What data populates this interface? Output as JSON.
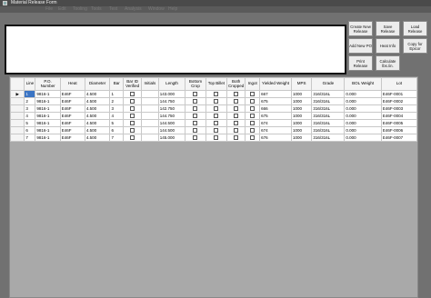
{
  "window": {
    "title": "Material Release Form"
  },
  "menu": {
    "items": [
      "File",
      "Edit",
      "Tooling",
      "Tools",
      "Test",
      "Analysis",
      "Window",
      "Help"
    ]
  },
  "buttons": {
    "create_new_release": "Create New Release",
    "save_release": "Save Release",
    "load_release": "Load Release",
    "add_new_po": "Add New PO",
    "heat_info": "Heat Info",
    "copy_for_epicor": "Copy for Epicor",
    "print_release": "Print Release",
    "calculate_lbs_in": "Calculate lbs./in."
  },
  "grid": {
    "columns": [
      "Line",
      "P.O. Number",
      "Heat",
      "Diameter",
      "Bar",
      "Bar ID Verified",
      "Initials",
      "Length",
      "Bottom Crop",
      "Top Billet",
      "Both Cropped",
      "Ingot",
      "Yielded Weight",
      "MPS",
      "Grade",
      "BOL Weight",
      "Lot"
    ],
    "rows": [
      {
        "line": "1",
        "po": "9816-1",
        "heat": "E46F",
        "diameter": "4.500",
        "bar": "1",
        "length": "143.000",
        "yielded": "667",
        "mps": "1000",
        "grade": "316/316L",
        "bol": "0.000",
        "lot": "E46F-0001"
      },
      {
        "line": "2",
        "po": "9816-1",
        "heat": "E46F",
        "diameter": "4.500",
        "bar": "2",
        "length": "144.750",
        "yielded": "675",
        "mps": "1000",
        "grade": "316/316L",
        "bol": "0.000",
        "lot": "E46F-0002"
      },
      {
        "line": "3",
        "po": "9816-1",
        "heat": "E46F",
        "diameter": "4.500",
        "bar": "3",
        "length": "142.750",
        "yielded": "666",
        "mps": "1000",
        "grade": "316/316L",
        "bol": "0.000",
        "lot": "E46F-0003"
      },
      {
        "line": "4",
        "po": "9816-1",
        "heat": "E46F",
        "diameter": "4.500",
        "bar": "4",
        "length": "144.750",
        "yielded": "675",
        "mps": "1000",
        "grade": "316/316L",
        "bol": "0.000",
        "lot": "E46F-0004"
      },
      {
        "line": "5",
        "po": "9816-1",
        "heat": "E46F",
        "diameter": "4.500",
        "bar": "5",
        "length": "144.500",
        "yielded": "674",
        "mps": "1000",
        "grade": "316/316L",
        "bol": "0.000",
        "lot": "E46F-0005"
      },
      {
        "line": "6",
        "po": "9816-1",
        "heat": "E46F",
        "diameter": "4.500",
        "bar": "6",
        "length": "144.500",
        "yielded": "674",
        "mps": "1000",
        "grade": "316/316L",
        "bol": "0.000",
        "lot": "E46F-0006"
      },
      {
        "line": "7",
        "po": "9816-1",
        "heat": "E46F",
        "diameter": "4.500",
        "bar": "7",
        "length": "145.000",
        "yielded": "676",
        "mps": "1000",
        "grade": "316/316L",
        "bol": "0.000",
        "lot": "E46F-0007"
      }
    ],
    "current_row_marker": "▶"
  }
}
